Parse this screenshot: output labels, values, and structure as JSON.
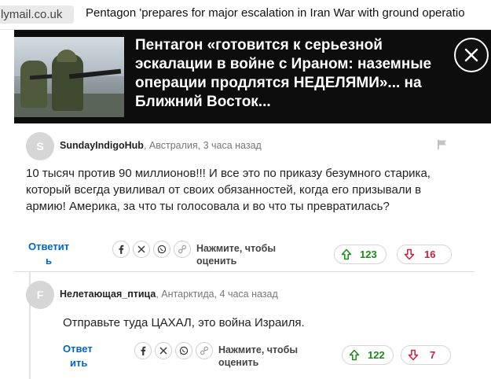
{
  "browser": {
    "domain": "lymail.co.uk",
    "tab_title": "Pentagon 'prepares for major escalation in Iran War with ground operatio"
  },
  "banner": {
    "headline": "Пентагон «готовится к серьезной эскалации в войне с Ираном: наземные операции продлятся НЕДЕЛЯМИ»... на Ближний Восток..."
  },
  "comments": [
    {
      "avatar_letter": "S",
      "author": "SundayIndigoHub",
      "meta": ", Австралия, 3 часа назад",
      "text": "10 тысяч против 90 миллионов!!! И все это по приказу безумного старика, который всегда увиливал от своих обязанностей, когда его призывали в армию! Америка, за что ты голосовала и во что ты превратилась?",
      "reply_label_1": "Ответит",
      "reply_label_2": "ь",
      "rate_label_1": "Нажмите, чтобы",
      "rate_label_2": "оценить",
      "upvotes": "123",
      "downvotes": "16"
    },
    {
      "avatar_letter": "F",
      "author": "Нелетающая_птица",
      "meta": ", Антарктида, 4 часа назад",
      "text": "Отправьте туда ЦАХАЛ, это война Израиля.",
      "reply_label_1": "Ответ",
      "reply_label_2": "ить",
      "rate_label_1": "Нажмите, чтобы",
      "rate_label_2": "оценить",
      "upvotes": "122",
      "downvotes": "7"
    }
  ],
  "icons": {
    "share": [
      "facebook-icon",
      "x-icon",
      "whatsapp-icon",
      "link-icon"
    ],
    "vote_up": "arrow-up-icon",
    "vote_down": "arrow-down-icon",
    "report": "flag-icon",
    "close": "close-icon"
  },
  "colors": {
    "reply": "#0066cc",
    "upvote": "#1a8a1a",
    "downvote": "#cc1f3a",
    "banner_bg": "#0d0d0d"
  }
}
